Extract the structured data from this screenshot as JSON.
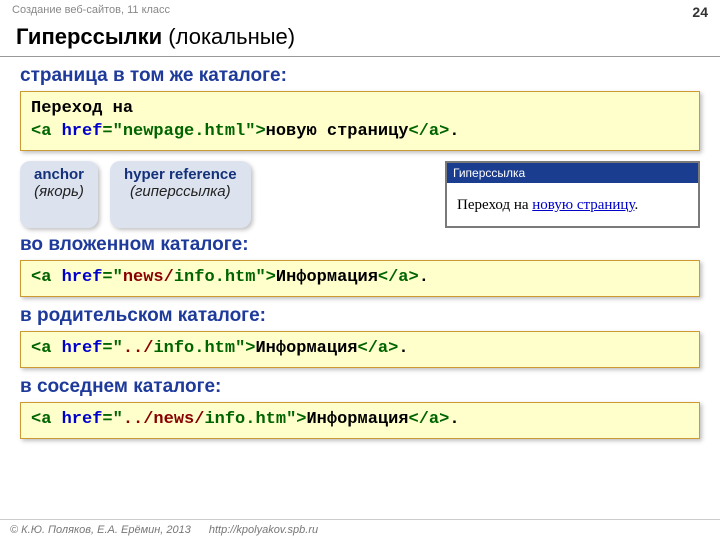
{
  "header": {
    "course": "Создание веб-сайтов, 11 класс",
    "page_number": "24"
  },
  "title": {
    "bold": "Гиперссылки",
    "rest": " (локальные)"
  },
  "sections": {
    "same_dir": {
      "label": "страница в том же каталоге:",
      "code": {
        "line1": "Переход на",
        "tag_open": "<a",
        "attr_name": "href",
        "eq": "=",
        "attr_val": "\"newpage.html\"",
        "gt": ">",
        "link_text": "новую страницу",
        "tag_close": "</a>",
        "dot": "."
      }
    },
    "pills": {
      "anchor_en": "anchor",
      "anchor_ru": "(якорь)",
      "href_en": "hyper reference",
      "href_ru": "(гиперссылка)"
    },
    "preview": {
      "window_title": "Гиперссылка",
      "prefix": "Переход на ",
      "link": "новую страницу",
      "suffix": "."
    },
    "nested": {
      "label": "во вложенном каталоге:",
      "code": {
        "tag_open": "<a",
        "attr_name": "href",
        "eq": "=",
        "q1": "\"",
        "path": "news/",
        "file": "info.htm",
        "q2": "\"",
        "gt": ">",
        "link_text": "Информация",
        "tag_close": "</a>",
        "dot": "."
      }
    },
    "parent": {
      "label": "в родительском каталоге:",
      "code": {
        "tag_open": "<a",
        "attr_name": "href",
        "eq": "=",
        "q1": "\"",
        "path": "../",
        "file": "info.htm",
        "q2": "\"",
        "gt": ">",
        "link_text": "Информация",
        "tag_close": "</a>",
        "dot": "."
      }
    },
    "sibling": {
      "label": "в соседнем каталоге:",
      "code": {
        "tag_open": "<a",
        "attr_name": "href",
        "eq": "=",
        "q1": "\"",
        "path": "../news/",
        "file": "info.htm",
        "q2": "\"",
        "gt": ">",
        "link_text": "Информация",
        "tag_close": "</a>",
        "dot": "."
      }
    }
  },
  "footer": {
    "copyright": "© К.Ю. Поляков, Е.А. Ерёмин, 2013",
    "url": "http://kpolyakov.spb.ru"
  }
}
